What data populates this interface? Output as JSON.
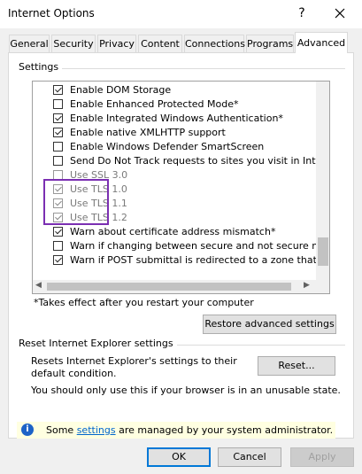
{
  "window": {
    "title": "Internet Options",
    "help_glyph": "?",
    "close_glyph": "✕"
  },
  "tabs": [
    {
      "label": "General"
    },
    {
      "label": "Security"
    },
    {
      "label": "Privacy"
    },
    {
      "label": "Content"
    },
    {
      "label": "Connections"
    },
    {
      "label": "Programs"
    },
    {
      "label": "Advanced",
      "active": true
    }
  ],
  "settings": {
    "group_label": "Settings",
    "items": [
      {
        "label": "Enable DOM Storage",
        "checked": true,
        "disabled": false
      },
      {
        "label": "Enable Enhanced Protected Mode*",
        "checked": false,
        "disabled": false
      },
      {
        "label": "Enable Integrated Windows Authentication*",
        "checked": true,
        "disabled": false
      },
      {
        "label": "Enable native XMLHTTP support",
        "checked": true,
        "disabled": false
      },
      {
        "label": "Enable Windows Defender SmartScreen",
        "checked": false,
        "disabled": false
      },
      {
        "label": "Send Do Not Track requests to sites you visit in Internet E",
        "checked": false,
        "disabled": false
      },
      {
        "label": "Use SSL 3.0",
        "checked": false,
        "disabled": true
      },
      {
        "label": "Use TLS 1.0",
        "checked": true,
        "disabled": true
      },
      {
        "label": "Use TLS 1.1",
        "checked": true,
        "disabled": true
      },
      {
        "label": "Use TLS 1.2",
        "checked": true,
        "disabled": true
      },
      {
        "label": "Warn about certificate address mismatch*",
        "checked": true,
        "disabled": false
      },
      {
        "label": "Warn if changing between secure and not secure mode",
        "checked": false,
        "disabled": false
      },
      {
        "label": "Warn if POST submittal is redirected to a zone that does n",
        "checked": true,
        "disabled": false
      }
    ],
    "footnote": "*Takes effect after you restart your computer",
    "restore_button": "Restore advanced settings"
  },
  "reset": {
    "group_label": "Reset Internet Explorer settings",
    "description": "Resets Internet Explorer's settings to their default condition.",
    "button": "Reset...",
    "warning": "You should only use this if your browser is in an unusable state."
  },
  "info": {
    "icon": "i",
    "text_before": "Some ",
    "link": "settings",
    "text_after": " are managed by your system administrator."
  },
  "buttons": {
    "ok": "OK",
    "cancel": "Cancel",
    "apply": "Apply"
  },
  "colors": {
    "highlight": "#7b2fb2",
    "accent": "#0078d7",
    "info_bg": "#ffffe1"
  }
}
